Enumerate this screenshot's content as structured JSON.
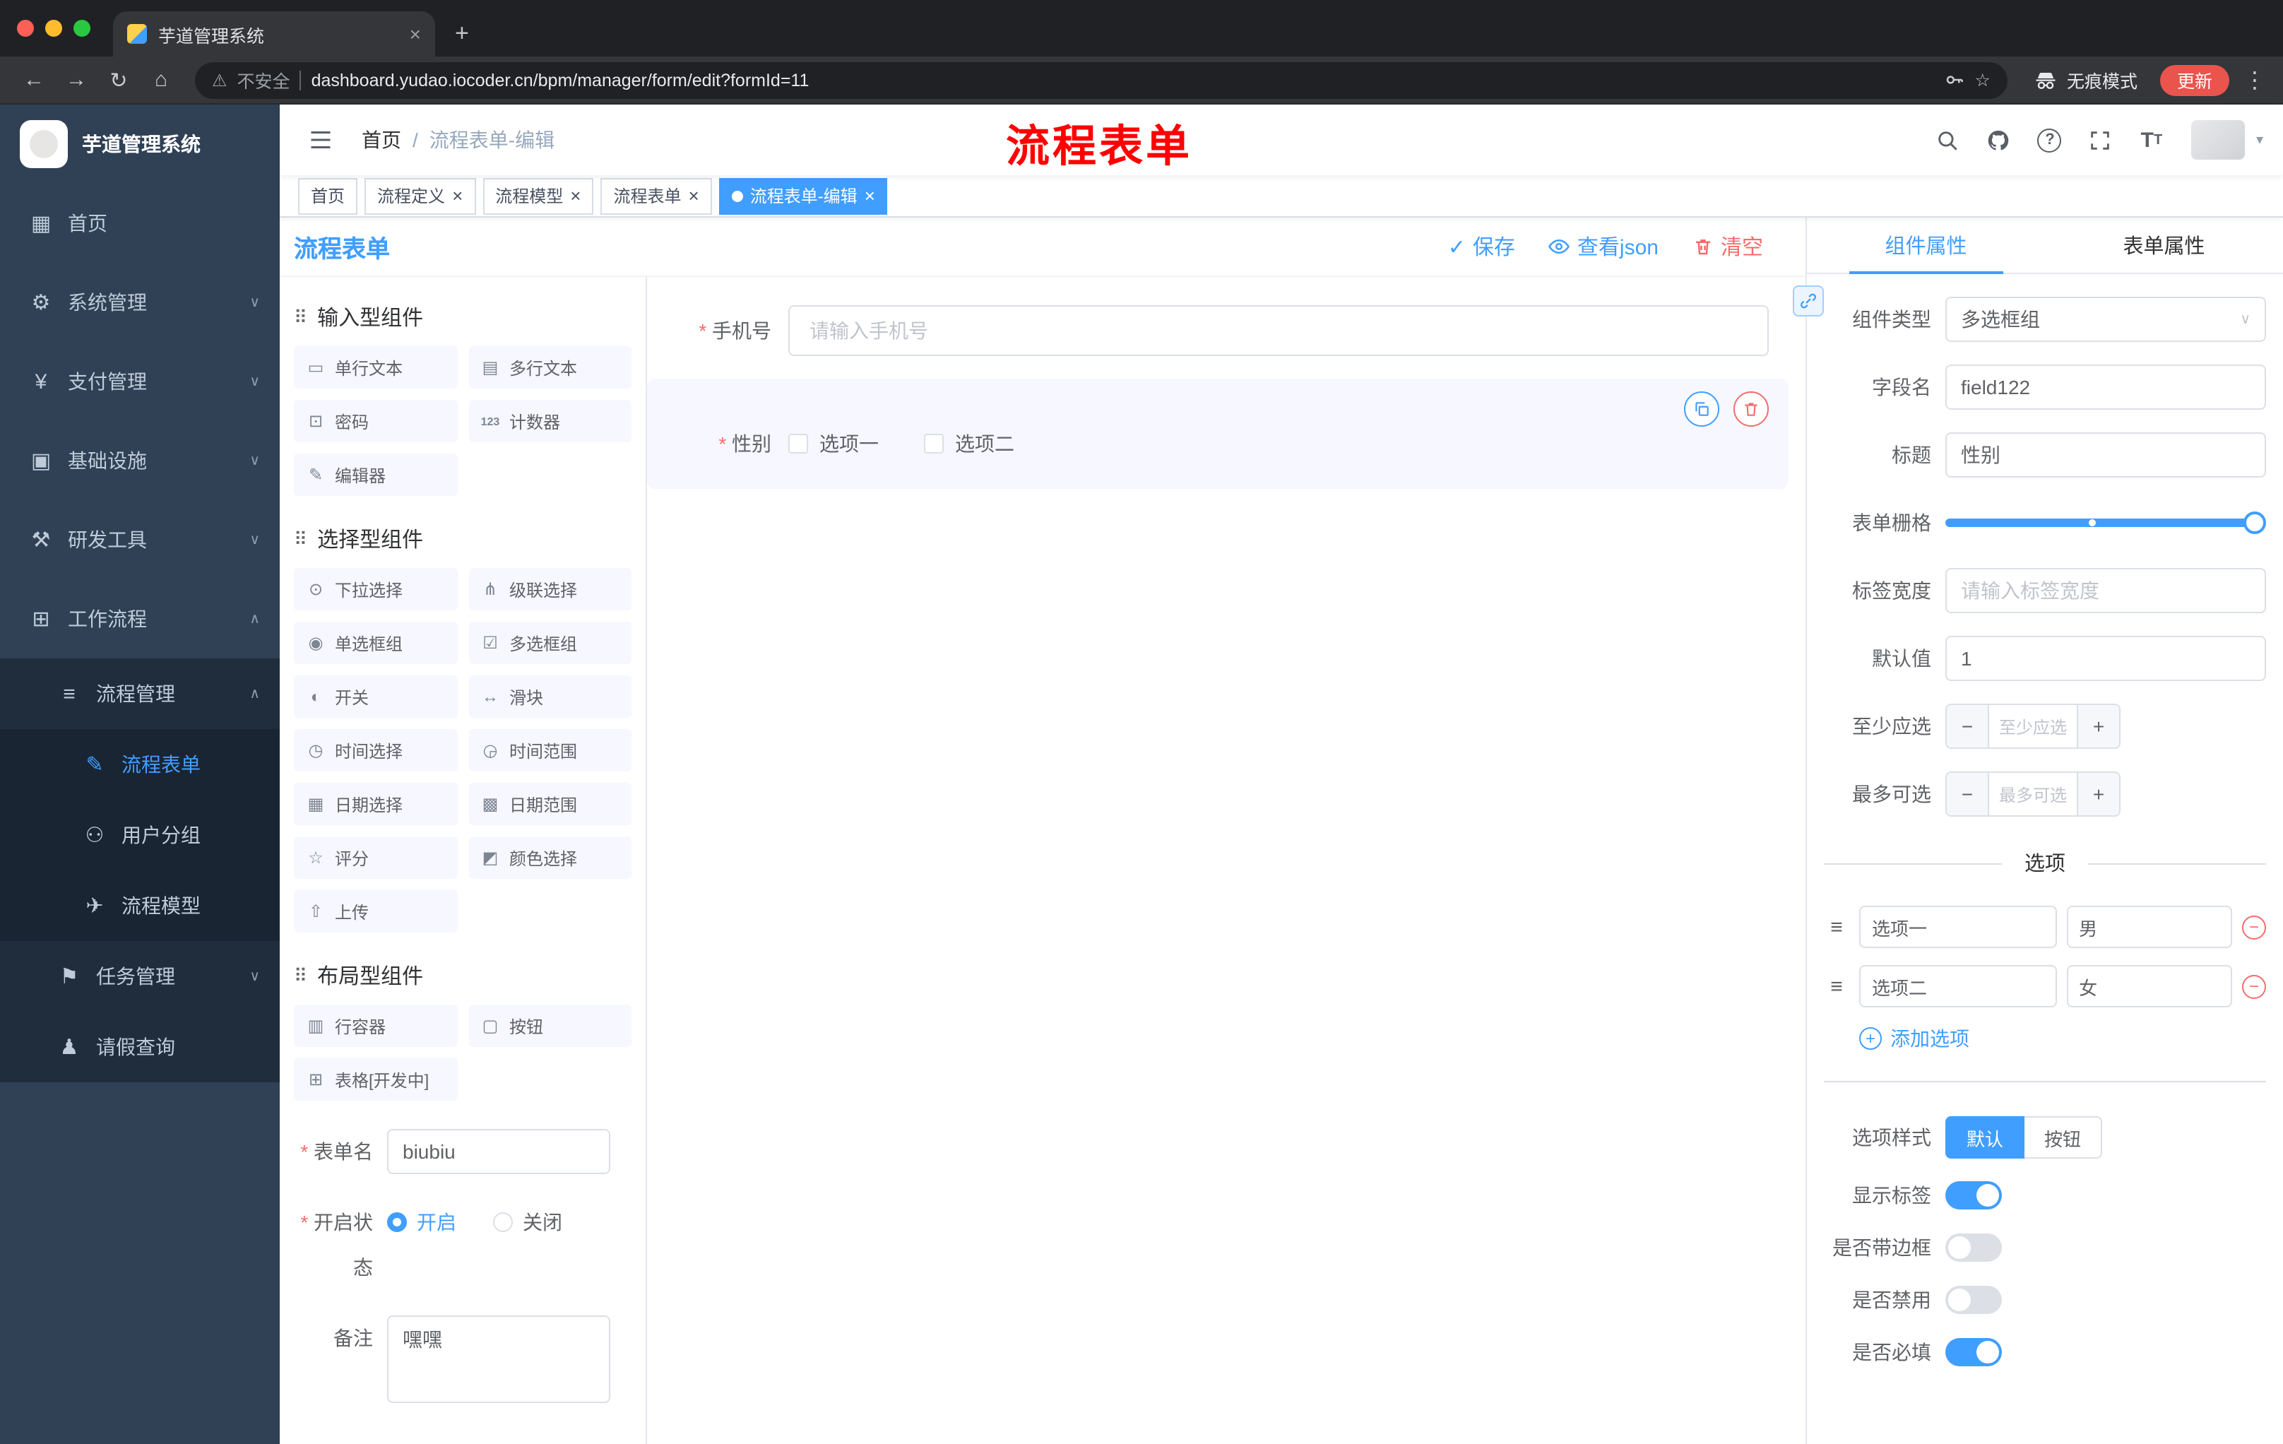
{
  "colors": {
    "primary": "#409eff",
    "danger": "#f56c6c",
    "annotation": "#ff0000",
    "sidebar_bg": "#304156",
    "submenu_bg": "#1f2d3d",
    "active_tag_bg": "#409eff"
  },
  "icons": {
    "check": "✓",
    "close": "×",
    "plus": "+",
    "minus": "−",
    "back": "←",
    "forward": "→",
    "reload": "↻",
    "home": "⌂",
    "warning": "⚠",
    "star": "☆",
    "dots": "⋮",
    "chevron_down": "∨",
    "chevron_up": "∧",
    "caret_down": "▾",
    "drag": "⠿",
    "option_handle": "≡",
    "question": "?",
    "font_large": "T",
    "font_small": "T"
  },
  "browser": {
    "tab_title": "芋道管理系统",
    "security_label": "不安全",
    "url": "dashboard.yudao.iocoder.cn/bpm/manager/form/edit?formId=11",
    "incognito_label": "无痕模式",
    "update_label": "更新"
  },
  "annotation": {
    "text": "流程表单"
  },
  "sidebar": {
    "logo_title": "芋道管理系统",
    "items": [
      {
        "label": "首页",
        "icon": "▦"
      },
      {
        "label": "系统管理",
        "icon": "⚙"
      },
      {
        "label": "支付管理",
        "icon": "¥"
      },
      {
        "label": "基础设施",
        "icon": "▣"
      },
      {
        "label": "研发工具",
        "icon": "⚒"
      },
      {
        "label": "工作流程",
        "icon": "⊞"
      },
      {
        "label": "流程管理",
        "icon": "≡"
      },
      {
        "label": "流程表单",
        "icon": "✎"
      },
      {
        "label": "用户分组",
        "icon": "⚇"
      },
      {
        "label": "流程模型",
        "icon": "✈"
      },
      {
        "label": "任务管理",
        "icon": "⚑"
      },
      {
        "label": "请假查询",
        "icon": "♟"
      }
    ]
  },
  "navbar": {
    "breadcrumb_home": "首页",
    "breadcrumb_sep": "/",
    "breadcrumb_current": "流程表单-编辑"
  },
  "tags": [
    {
      "label": "首页"
    },
    {
      "label": "流程定义"
    },
    {
      "label": "流程模型"
    },
    {
      "label": "流程表单"
    },
    {
      "label": "流程表单-编辑"
    }
  ],
  "toolbar": {
    "title": "流程表单",
    "save_label": "保存",
    "view_json_label": "查看json",
    "clear_label": "清空"
  },
  "components_panel": {
    "groups": [
      {
        "title": "输入型组件",
        "items": [
          {
            "label": "单行文本",
            "icon": "▭"
          },
          {
            "label": "多行文本",
            "icon": "▤"
          },
          {
            "label": "密码",
            "icon": "⊡"
          },
          {
            "label": "计数器",
            "icon": "123"
          },
          {
            "label": "编辑器",
            "icon": "✎"
          }
        ]
      },
      {
        "title": "选择型组件",
        "items": [
          {
            "label": "下拉选择",
            "icon": "⊙"
          },
          {
            "label": "级联选择",
            "icon": "⋔"
          },
          {
            "label": "单选框组",
            "icon": "◉"
          },
          {
            "label": "多选框组",
            "icon": "☑"
          },
          {
            "label": "开关",
            "icon": "◐"
          },
          {
            "label": "滑块",
            "icon": "↔"
          },
          {
            "label": "时间选择",
            "icon": "◷"
          },
          {
            "label": "时间范围",
            "icon": "◶"
          },
          {
            "label": "日期选择",
            "icon": "▦"
          },
          {
            "label": "日期范围",
            "icon": "▩"
          },
          {
            "label": "评分",
            "icon": "☆"
          },
          {
            "label": "颜色选择",
            "icon": "◩"
          },
          {
            "label": "上传",
            "icon": "⇧"
          }
        ]
      },
      {
        "title": "布局型组件",
        "items": [
          {
            "label": "行容器",
            "icon": "▥"
          },
          {
            "label": "按钮",
            "icon": "▢"
          },
          {
            "label": "表格[开发中]",
            "icon": "⊞"
          }
        ]
      }
    ],
    "form": {
      "name_label": "表单名",
      "name_value": "biubiu",
      "status_label": "开启状态",
      "status_on": "开启",
      "status_off": "关闭",
      "remark_label": "备注",
      "remark_value": "嘿嘿"
    }
  },
  "canvas": {
    "phone": {
      "label": "手机号",
      "placeholder": "请输入手机号"
    },
    "gender": {
      "label": "性别",
      "option1": "选项一",
      "option2": "选项二"
    }
  },
  "properties": {
    "tab_component": "组件属性",
    "tab_form": "表单属性",
    "rows": {
      "type_label": "组件类型",
      "type_value": "多选框组",
      "field_label": "字段名",
      "field_value": "field122",
      "title_label": "标题",
      "title_value": "性别",
      "grid_label": "表单栅格",
      "width_label": "标签宽度",
      "width_placeholder": "请输入标签宽度",
      "default_label": "默认值",
      "default_value": "1",
      "min_label": "至少应选",
      "min_placeholder": "至少应选",
      "max_label": "最多可选",
      "max_placeholder": "最多可选"
    },
    "options_divider": "选项",
    "options": [
      {
        "label": "选项一",
        "value": "男"
      },
      {
        "label": "选项二",
        "value": "女"
      }
    ],
    "add_option": "添加选项",
    "style_label": "选项样式",
    "style_default": "默认",
    "style_button": "按钮",
    "switch_rows": {
      "show_label": "显示标签",
      "border_label": "是否带边框",
      "disabled_label": "是否禁用",
      "required_label": "是否必填"
    }
  }
}
